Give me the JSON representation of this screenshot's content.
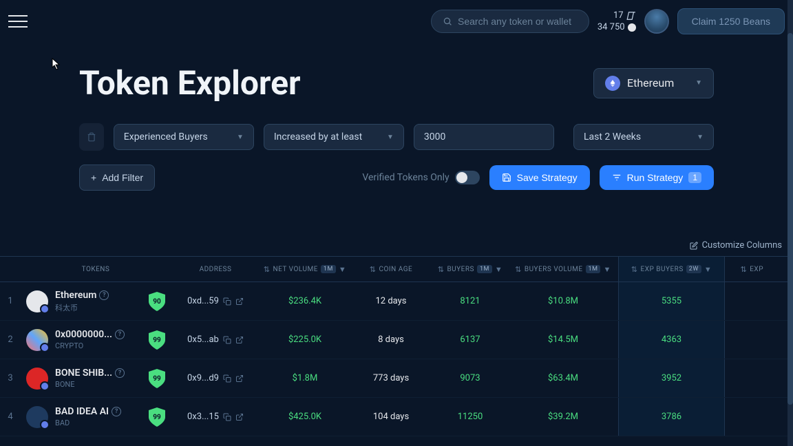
{
  "header": {
    "search_placeholder": "Search any token or wallet",
    "stat1": "17",
    "stat2": "34 750",
    "claim_label": "Claim 1250 Beans"
  },
  "page": {
    "title": "Token Explorer",
    "network": "Ethereum"
  },
  "filters": {
    "f1": "Experienced Buyers",
    "f2": "Increased by at least",
    "f3": "3000",
    "f4": "Last 2 Weeks",
    "add_filter": "Add Filter",
    "verified_label": "Verified Tokens Only",
    "save_strategy": "Save Strategy",
    "run_strategy": "Run Strategy",
    "run_badge": "1"
  },
  "table": {
    "customize": "Customize Columns",
    "headers": {
      "tokens": "TOKENS",
      "address": "ADDRESS",
      "net_volume": "NET VOLUME",
      "net_volume_tag": "1M",
      "coin_age": "COIN AGE",
      "buyers": "BUYERS",
      "buyers_tag": "1M",
      "buyers_volume": "BUYERS VOLUME",
      "buyers_volume_tag": "1M",
      "exp_buyers": "EXP BUYERS",
      "exp_buyers_tag": "2W",
      "exp": "EXP"
    },
    "rows": [
      {
        "idx": "1",
        "name": "Ethereum",
        "symbol": "科太币",
        "shield": "90",
        "icon_bg": "#e5e7eb",
        "addr": "0xd...59",
        "volume": "$236.4K",
        "age": "12 days",
        "buyers": "8121",
        "bvol": "$10.8M",
        "exp": "5355"
      },
      {
        "idx": "2",
        "name": "0x0000000...",
        "symbol": "CRYPTO",
        "shield": "99",
        "icon_bg": "linear-gradient(45deg,#f87171,#60a5fa,#fbbf24)",
        "addr": "0x5...ab",
        "volume": "$225.0K",
        "age": "8 days",
        "buyers": "6137",
        "bvol": "$14.5M",
        "exp": "4363"
      },
      {
        "idx": "3",
        "name": "BONE SHIB...",
        "symbol": "BONE",
        "shield": "99",
        "icon_bg": "#dc2626",
        "addr": "0x9...d9",
        "volume": "$1.8M",
        "age": "773 days",
        "buyers": "9073",
        "bvol": "$63.4M",
        "exp": "3952"
      },
      {
        "idx": "4",
        "name": "BAD IDEA AI",
        "symbol": "BAD",
        "shield": "99",
        "icon_bg": "#1e3a5f",
        "addr": "0x3...15",
        "volume": "$425.0K",
        "age": "104 days",
        "buyers": "11250",
        "bvol": "$39.2M",
        "exp": "3786"
      }
    ]
  }
}
